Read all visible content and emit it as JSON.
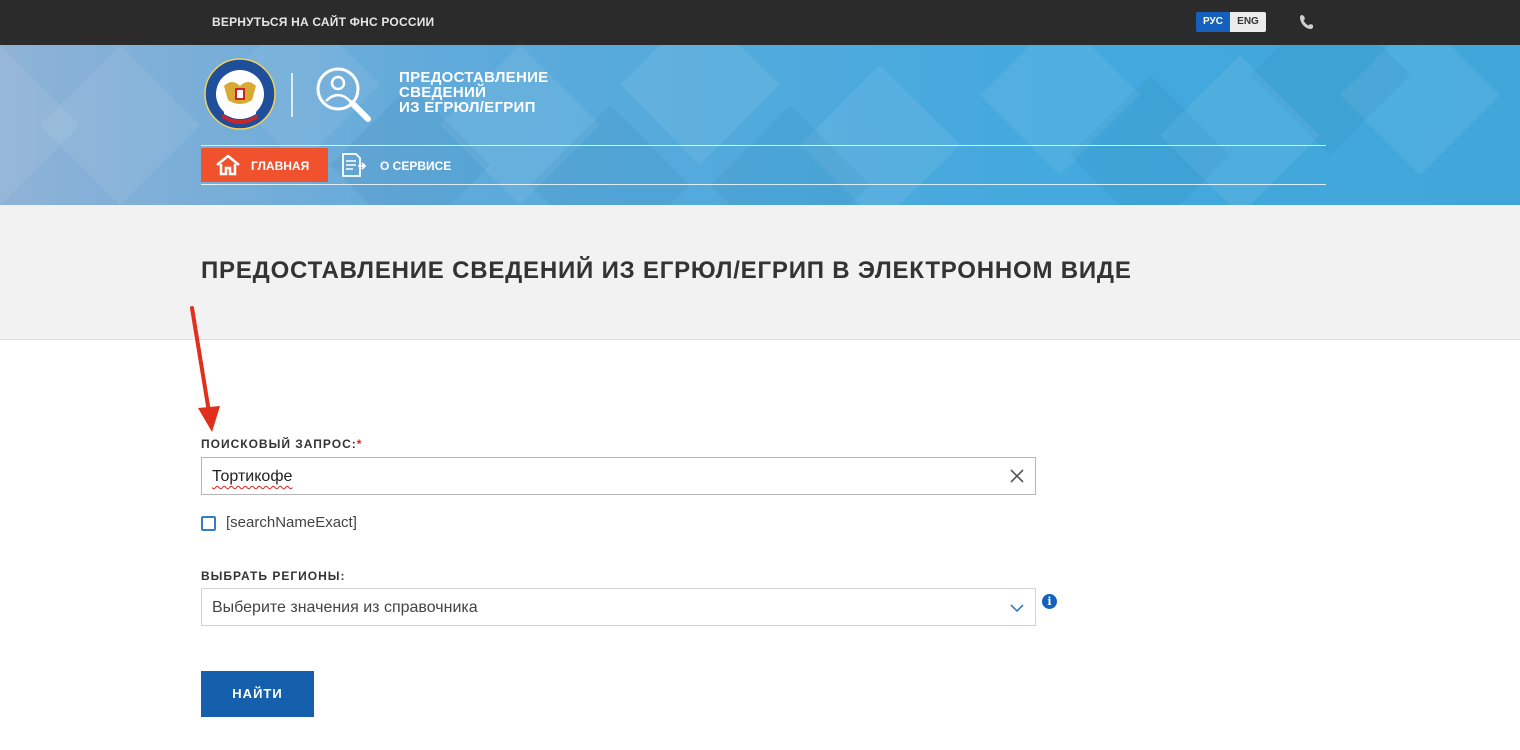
{
  "topbar": {
    "back_link": "ВЕРНУТЬСЯ НА САЙТ ФНС РОССИИ",
    "lang_ru": "РУС",
    "lang_en": "ENG",
    "phone_icon": "phone-icon"
  },
  "header": {
    "emblem_icon": "fns-emblem-icon",
    "service_icon": "magnifier-person-icon",
    "service_title_lines": [
      "ПРЕДОСТАВЛЕНИЕ",
      "СВЕДЕНИЙ",
      "ИЗ ЕГРЮЛ/ЕГРИП"
    ],
    "nav": {
      "home_label": "ГЛАВНАЯ",
      "home_icon": "home-icon",
      "about_label": "О СЕРВИСЕ",
      "about_icon": "document-icon"
    }
  },
  "main": {
    "page_title": "ПРЕДОСТАВЛЕНИЕ СВЕДЕНИЙ ИЗ ЕГРЮЛ/ЕГРИП В ЭЛЕКТРОННОМ ВИДЕ",
    "search": {
      "label": "ПОИСКОВЫЙ ЗАПРОС:",
      "required_mark": "*",
      "value": "Тортикофе",
      "clear_icon": "close-icon"
    },
    "exact_checkbox": {
      "label": "[searchNameExact]",
      "checked": false
    },
    "regions": {
      "label": "ВЫБРАТЬ РЕГИОНЫ:",
      "placeholder": "Выберите значения из справочника",
      "chevron_icon": "chevron-down-icon",
      "info_icon": "info-icon",
      "info_glyph": "i"
    },
    "submit_label": "НАЙТИ"
  },
  "colors": {
    "topbar": "#2b2b2b",
    "accent_orange": "#f0522e",
    "primary_blue": "#1560ad",
    "annotation_arrow": "#e0301c"
  }
}
